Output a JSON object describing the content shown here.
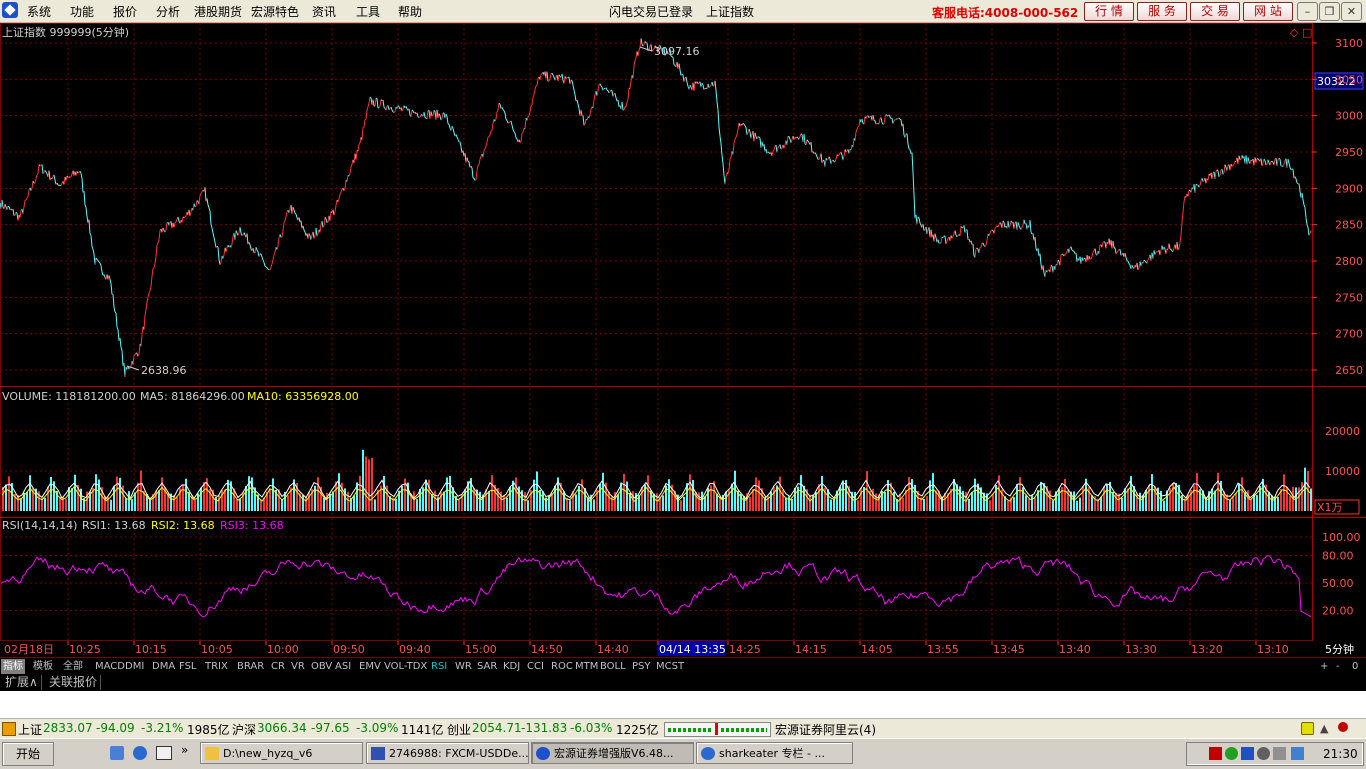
{
  "menu": {
    "items": [
      "系统",
      "功能",
      "报价",
      "分析",
      "港股期货",
      "宏源特色",
      "资讯",
      "工具",
      "帮助"
    ],
    "status_login": "闪电交易已登录",
    "status_index": "上证指数",
    "hotline": "客服电话:4008-000-562",
    "quick_buttons": [
      "行 情",
      "服 务",
      "交 易",
      "网 站"
    ]
  },
  "price_panel": {
    "title": "上证指数 999999(5分钟)",
    "high_label": "3097.16",
    "low_label": "2638.96",
    "current_tag": "3032.2",
    "y_ticks": [
      "3100",
      "3050",
      "3000",
      "2950",
      "2900",
      "2850",
      "2800",
      "2750",
      "2700",
      "2650"
    ]
  },
  "volume_panel": {
    "label_volume": "VOLUME: 118181200.00",
    "label_ma5": "MA5: 81864296.00",
    "label_ma10": "MA10: 63356928.00",
    "y_ticks": [
      "20000",
      "10000"
    ],
    "unit": "X1万"
  },
  "rsi_panel": {
    "label_name": "RSI(14,14,14)",
    "label_rsi1": "RSI1: 13.68",
    "label_rsi2": "RSI2: 13.68",
    "label_rsi3": "RSI3: 13.68",
    "y_ticks": [
      "100.00",
      "80.00",
      "50.00",
      "20.00"
    ]
  },
  "time_axis": {
    "labels": [
      "02月18日",
      "10:25",
      "10:15",
      "10:05",
      "10:00",
      "09:50",
      "09:40",
      "15:00",
      "14:50",
      "14:40",
      "04/14 13:35",
      "14:25",
      "14:15",
      "14:05",
      "13:55",
      "13:45",
      "13:40",
      "13:30",
      "13:20",
      "13:10"
    ],
    "period": "5分钟"
  },
  "indicator_tabs": [
    "指标",
    "模板",
    "全部",
    "MACD",
    "DMI",
    "DMA",
    "FSL",
    "TRIX",
    "BRAR",
    "CR",
    "VR",
    "OBV",
    "ASI",
    "EMV",
    "VOL-TDX",
    "RSI",
    "WR",
    "SAR",
    "KDJ",
    "CCI",
    "ROC",
    "MTM",
    "BOLL",
    "PSY",
    "MCST"
  ],
  "tab_controls": [
    "+",
    "-",
    "0"
  ],
  "sub_tabs": [
    "扩展∧",
    "关联报价"
  ],
  "statusbar": {
    "sh_name": "上证",
    "sh_value": "2833.07",
    "sh_change": "-94.09",
    "sh_pct": "-3.21%",
    "sh_amount": "1985亿",
    "sz_name": "沪深",
    "sz_value": "3066.34",
    "sz_change": "-97.65",
    "sz_pct": "-3.09%",
    "sz_amount": "1141亿",
    "cy_name": "创业",
    "cy_value": "2054.71",
    "cy_change": "-131.83",
    "cy_pct": "-6.03%",
    "cy_amount": "1225亿",
    "broker": "宏源证券阿里云(4)"
  },
  "taskbar": {
    "start": "开始",
    "tasks": [
      "D:\\new_hyzq_v6",
      "2746988: FXCM-USDDe...",
      "宏源证券增强版V6.48...",
      "sharkeater 专栏 - ..."
    ],
    "clock": "21:30"
  },
  "colors": {
    "up": "#ff3232",
    "down": "#54ffff",
    "grid": "#7a0000",
    "axis_text": "#ff5050",
    "rsi": "#ff00ff",
    "ma5": "#ffffff",
    "ma10": "#ffff00",
    "accent": "#e00000"
  }
}
